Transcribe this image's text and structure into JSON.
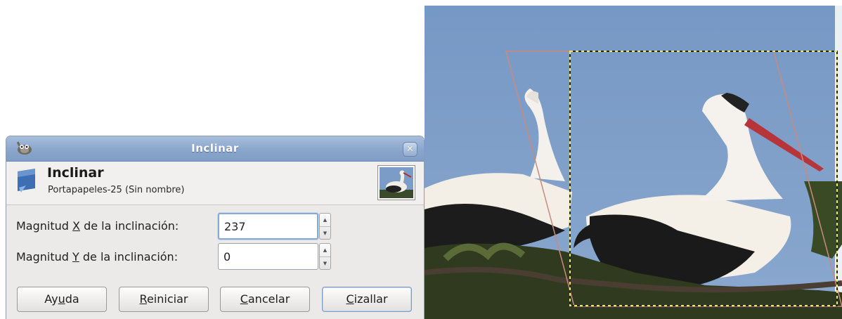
{
  "dialog": {
    "window_title": "Inclinar",
    "tool_title": "Inclinar",
    "subtitle": "Portapapeles-25 (Sin nombre)",
    "icons": {
      "app": "gimp-icon",
      "close": "close-icon",
      "tool": "shear-tool-icon",
      "preview": "layer-thumbnail"
    },
    "fields": [
      {
        "label_pre": "Magnitud ",
        "label_key": "X",
        "label_post": " de la inclinación:",
        "value": "237"
      },
      {
        "label_pre": "Magnitud ",
        "label_key": "Y",
        "label_post": " de la inclinación:",
        "value": "0"
      }
    ],
    "buttons": {
      "help": {
        "pre": "Ay",
        "key": "u",
        "post": "da"
      },
      "reset": {
        "pre": "",
        "key": "R",
        "post": "einiciar"
      },
      "cancel": {
        "pre": "",
        "key": "C",
        "post": "ancelar"
      },
      "shear": {
        "pre": "",
        "key": "C",
        "post": "izallar"
      }
    }
  },
  "canvas": {
    "description_colors": {
      "sky": "#7b9cc6",
      "shear_outline": "#c98a7e",
      "selection_marquee": "#f2e36a"
    }
  }
}
